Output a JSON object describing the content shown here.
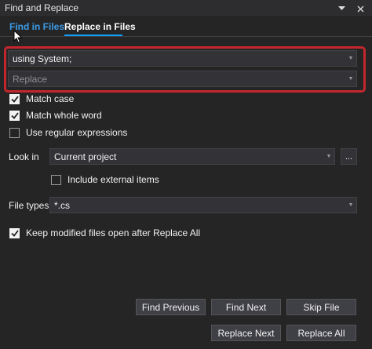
{
  "window": {
    "title": "Find and Replace",
    "dropdown_icon": "chevron-down-icon",
    "close_icon": "close-icon"
  },
  "tabs": [
    {
      "label": "Find in Files",
      "active": false
    },
    {
      "label": "Replace in Files",
      "active": true
    }
  ],
  "find": {
    "value": "using System;"
  },
  "replace": {
    "placeholder": "Replace"
  },
  "options": {
    "match_case": {
      "label": "Match case",
      "checked": true
    },
    "whole_word": {
      "label": "Match whole word",
      "checked": true
    },
    "regex": {
      "label": "Use regular expressions",
      "checked": false
    }
  },
  "look_in": {
    "label": "Look in",
    "value": "Current project",
    "browse_label": "...",
    "include_external": {
      "label": "Include external items",
      "checked": false
    }
  },
  "file_types": {
    "label": "File types",
    "value": "*.cs"
  },
  "keep_modified": {
    "label": "Keep modified files open after Replace All",
    "checked": true
  },
  "buttons": {
    "find_previous": "Find Previous",
    "find_next": "Find Next",
    "skip_file": "Skip File",
    "replace_next": "Replace Next",
    "replace_all": "Replace All"
  },
  "colors": {
    "background": "#252526",
    "accent": "#0e9ff8",
    "highlight_border": "#c4262e"
  }
}
